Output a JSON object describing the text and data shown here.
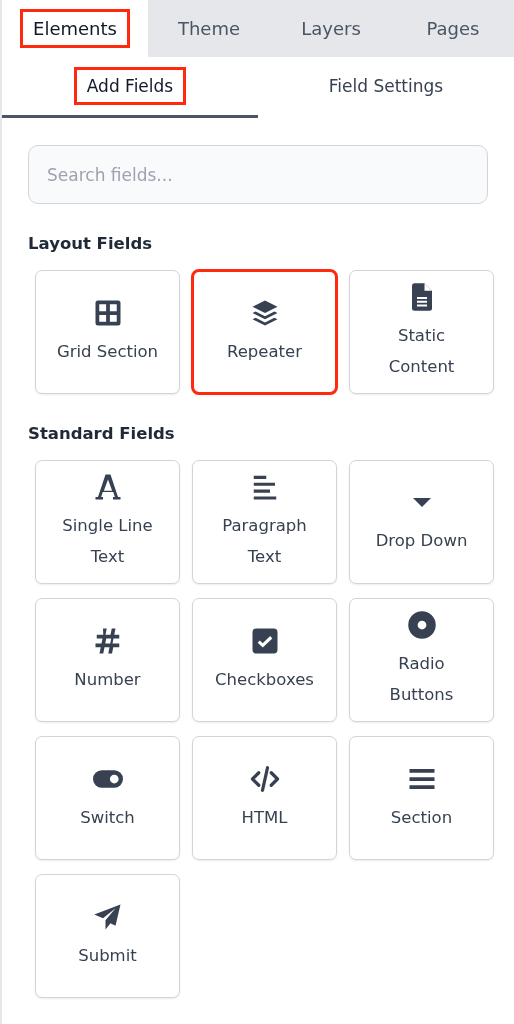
{
  "tabs": [
    {
      "label": "Elements",
      "selected": true,
      "highlighted": true
    },
    {
      "label": "Theme",
      "selected": false,
      "highlighted": false
    },
    {
      "label": "Layers",
      "selected": false,
      "highlighted": false
    },
    {
      "label": "Pages",
      "selected": false,
      "highlighted": false
    }
  ],
  "subtabs": [
    {
      "label": "Add Fields",
      "selected": true,
      "highlighted": true
    },
    {
      "label": "Field Settings",
      "selected": false,
      "highlighted": false
    }
  ],
  "search": {
    "placeholder": "Search fields..."
  },
  "groups": [
    {
      "title": "Layout Fields",
      "fields": [
        {
          "lines": [
            "Grid Section"
          ],
          "kind": "grid",
          "highlighted": false
        },
        {
          "lines": [
            "Repeater"
          ],
          "kind": "layers",
          "highlighted": true
        },
        {
          "lines": [
            "Static",
            "Content"
          ],
          "kind": "document",
          "highlighted": false
        }
      ]
    },
    {
      "title": "Standard Fields",
      "fields": [
        {
          "lines": [
            "Single Line",
            "Text"
          ],
          "kind": "letter",
          "highlighted": false
        },
        {
          "lines": [
            "Paragraph",
            "Text"
          ],
          "kind": "align",
          "highlighted": false
        },
        {
          "lines": [
            "Drop Down"
          ],
          "kind": "caret",
          "highlighted": false
        },
        {
          "lines": [
            "Number"
          ],
          "kind": "hash",
          "highlighted": false
        },
        {
          "lines": [
            "Checkboxes"
          ],
          "kind": "check",
          "highlighted": false
        },
        {
          "lines": [
            "Radio",
            "Buttons"
          ],
          "kind": "radio",
          "highlighted": false
        },
        {
          "lines": [
            "Switch"
          ],
          "kind": "toggle",
          "highlighted": false
        },
        {
          "lines": [
            "HTML"
          ],
          "kind": "code",
          "highlighted": false
        },
        {
          "lines": [
            "Section"
          ],
          "kind": "bars",
          "highlighted": false
        },
        {
          "lines": [
            "Submit"
          ],
          "kind": "plane",
          "highlighted": false
        }
      ]
    }
  ]
}
